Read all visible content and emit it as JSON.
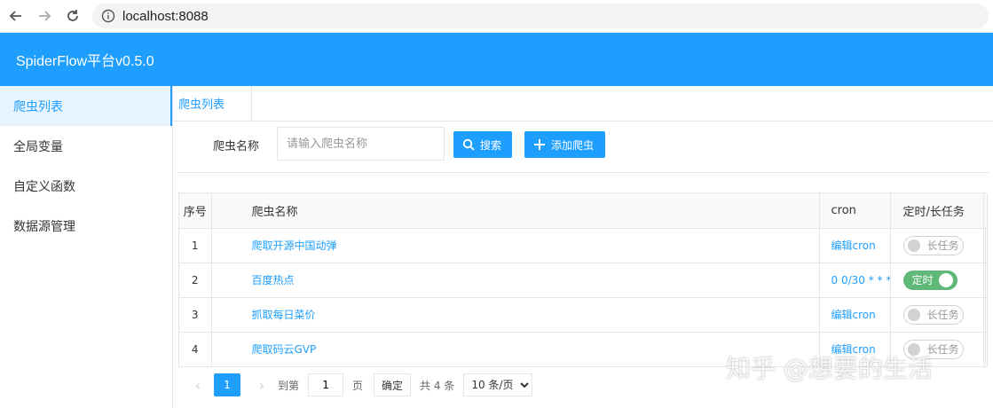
{
  "browser": {
    "url": "localhost:8088"
  },
  "header": {
    "title": "SpiderFlow平台v0.5.0"
  },
  "sidebar": {
    "items": [
      {
        "label": "爬虫列表"
      },
      {
        "label": "全局变量"
      },
      {
        "label": "自定义函数"
      },
      {
        "label": "数据源管理"
      }
    ]
  },
  "tabs": [
    {
      "label": "爬虫列表"
    }
  ],
  "search": {
    "label": "爬虫名称",
    "placeholder": "请输入爬虫名称",
    "search_button": "搜索",
    "add_button": "添加爬虫"
  },
  "table": {
    "headers": {
      "idx": "序号",
      "name": "爬虫名称",
      "cron": "cron",
      "task": "定时/长任务"
    },
    "rows": [
      {
        "idx": "1",
        "name": "爬取开源中国动弹",
        "cron": "编辑cron",
        "task": "长任务",
        "enabled": false
      },
      {
        "idx": "2",
        "name": "百度热点",
        "cron": "0 0/30 * * * ?",
        "task": "定时",
        "enabled": true
      },
      {
        "idx": "3",
        "name": "抓取每日菜价",
        "cron": "编辑cron",
        "task": "长任务",
        "enabled": false
      },
      {
        "idx": "4",
        "name": "爬取码云GVP",
        "cron": "编辑cron",
        "task": "长任务",
        "enabled": false
      }
    ]
  },
  "pager": {
    "current": "1",
    "goto_label": "到第",
    "goto_value": "1",
    "page_unit": "页",
    "confirm": "确定",
    "total": "共 4 条",
    "page_size": "10 条/页"
  },
  "watermark": "知乎 @想要的生活",
  "colors": {
    "primary": "#1e9fff",
    "switch_on": "#5fb878"
  }
}
